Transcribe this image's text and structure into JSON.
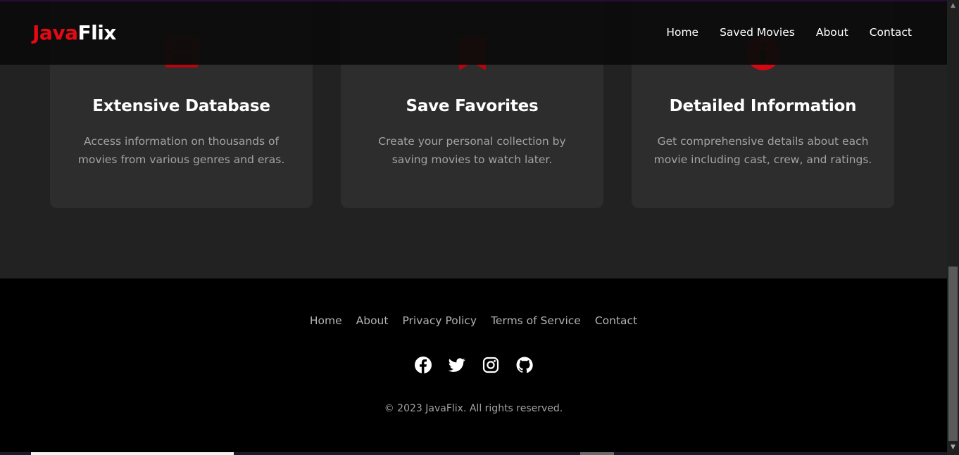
{
  "brand": {
    "part1": "Java",
    "part2": "Flix",
    "accent_color": "#e50914"
  },
  "nav": {
    "items": [
      {
        "label": "Home"
      },
      {
        "label": "Saved Movies"
      },
      {
        "label": "About"
      },
      {
        "label": "Contact"
      }
    ]
  },
  "features": [
    {
      "icon": "film-icon",
      "title": "Extensive Database",
      "description": "Access information on thousands of movies from various genres and eras."
    },
    {
      "icon": "bookmark-icon",
      "title": "Save Favorites",
      "description": "Create your personal collection by saving movies to watch later."
    },
    {
      "icon": "info-icon",
      "title": "Detailed Information",
      "description": "Get comprehensive details about each movie including cast, crew, and ratings."
    }
  ],
  "footer": {
    "links": [
      {
        "label": "Home"
      },
      {
        "label": "About"
      },
      {
        "label": "Privacy Policy"
      },
      {
        "label": "Terms of Service"
      },
      {
        "label": "Contact"
      }
    ],
    "social": [
      "facebook-icon",
      "twitter-icon",
      "instagram-icon",
      "github-icon"
    ],
    "copyright": "© 2023 JavaFlix. All rights reserved."
  }
}
